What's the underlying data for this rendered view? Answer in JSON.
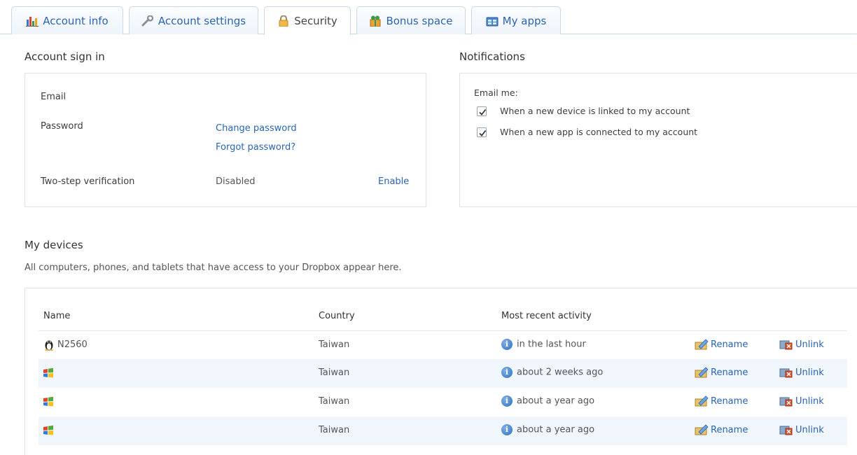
{
  "tabs": [
    {
      "label": "Account info",
      "icon": "bar-chart-icon",
      "active": false
    },
    {
      "label": "Account settings",
      "icon": "wrench-icon",
      "active": false
    },
    {
      "label": "Security",
      "icon": "padlock-icon",
      "active": true
    },
    {
      "label": "Bonus space",
      "icon": "gift-box-icon",
      "active": false
    },
    {
      "label": "My apps",
      "icon": "apps-folder-icon",
      "active": false
    }
  ],
  "signin": {
    "title": "Account sign in",
    "email_label": "Email",
    "password_label": "Password",
    "change_password": "Change password",
    "forgot_password": "Forgot password?",
    "twostep_label": "Two-step verification",
    "twostep_status": "Disabled",
    "twostep_action": "Enable"
  },
  "notifications": {
    "title": "Notifications",
    "email_me": "Email me:",
    "options": [
      {
        "label": "When a new device is linked to my account",
        "checked": true
      },
      {
        "label": "When a new app is connected to my account",
        "checked": true
      }
    ]
  },
  "devices": {
    "title": "My devices",
    "description": "All computers, phones, and tablets that have access to your Dropbox appear here.",
    "columns": {
      "name": "Name",
      "country": "Country",
      "activity": "Most recent activity"
    },
    "rename_label": "Rename",
    "unlink_label": "Unlink",
    "rows": [
      {
        "icon": "linux-penguin-icon",
        "name": "N2560",
        "country": "Taiwan",
        "activity": "in the last hour"
      },
      {
        "icon": "windows-logo-icon",
        "name": "",
        "country": "Taiwan",
        "activity": "about 2 weeks ago"
      },
      {
        "icon": "windows-logo-icon",
        "name": "",
        "country": "Taiwan",
        "activity": "about a year ago"
      },
      {
        "icon": "windows-logo-icon",
        "name": "",
        "country": "Taiwan",
        "activity": "about a year ago"
      }
    ]
  },
  "colors": {
    "link": "#2a64b4",
    "alt_row": "#f1f6fd",
    "tab_border": "#c8d8ea"
  }
}
